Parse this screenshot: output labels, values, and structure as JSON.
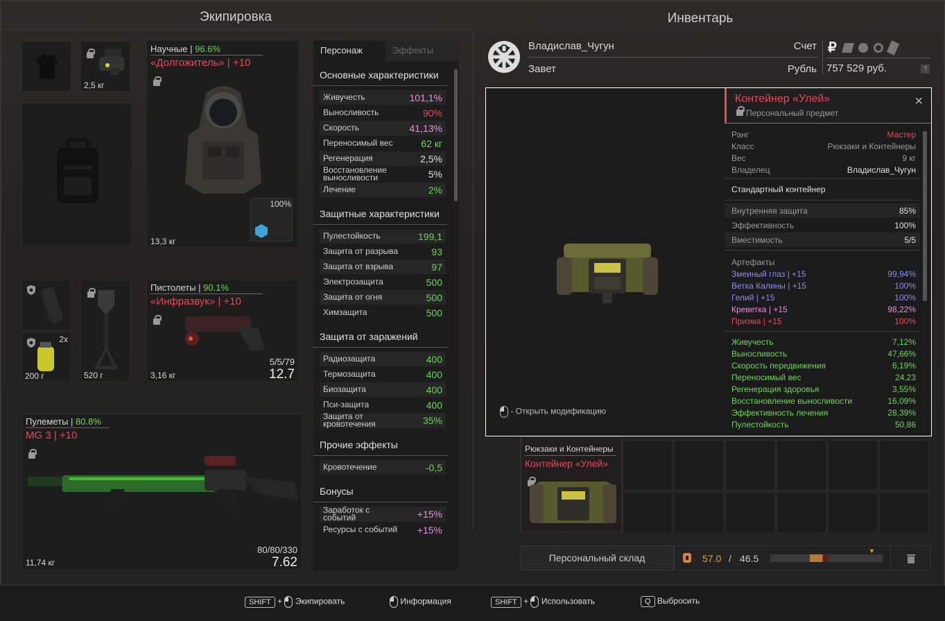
{
  "headers": {
    "equipment": "Экипировка",
    "inventory": "Инвентарь"
  },
  "slots": {
    "nv_weight": "2,5 кг",
    "armor": {
      "category": "Научные",
      "sep": " | ",
      "durability": "96.6%",
      "name": "«Долгожитель» | +10",
      "weight": "13,3 кг",
      "sub_pct": "100%"
    },
    "pistol": {
      "category": "Пистолеты",
      "sep": " | ",
      "durability": "90.1%",
      "name": "«Инфразвук» | +10",
      "weight": "3,16 кг",
      "ammo": "5/5/79",
      "dps": "12.7"
    },
    "consumable1_weight": "200 г",
    "consumable1_count": "2x",
    "shovel_weight": "520 г",
    "mg": {
      "category": "Пулеметы",
      "sep": " | ",
      "durability": "80.8%",
      "name": "MG 3 | +10",
      "weight": "11,74 кг",
      "ammo": "80/80/330",
      "dps": "7.62"
    }
  },
  "stats": {
    "tabs": [
      "Персонаж",
      "Эффекты"
    ],
    "sections": [
      {
        "title": "Основные характеристики",
        "rows": [
          {
            "label": "Живучесть",
            "value": "101,1%",
            "color": "#e98fde"
          },
          {
            "label": "Выносливость",
            "value": "90%",
            "color": "#e8485a"
          },
          {
            "label": "Скорость",
            "value": "41,13%",
            "color": "#e98fde"
          },
          {
            "label": "Переносимый вес",
            "value": "62 кг",
            "color": "#6fd45c"
          },
          {
            "label": "Регенерация",
            "value": "2,5%",
            "color": "#e0e0e0"
          },
          {
            "label": "Восстановление выносливости",
            "value": "5%",
            "color": "#e0e0e0"
          },
          {
            "label": "Лечение",
            "value": "2%",
            "color": "#6fd45c"
          }
        ]
      },
      {
        "title": "Защитные характеристики",
        "rows": [
          {
            "label": "Пулестойкость",
            "value": "199,1",
            "color": "#6fd45c"
          },
          {
            "label": "Защита от разрыва",
            "value": "93",
            "color": "#6fd45c"
          },
          {
            "label": "Защита от взрыва",
            "value": "97",
            "color": "#6fd45c"
          },
          {
            "label": "Электрозащита",
            "value": "500",
            "color": "#6fd45c"
          },
          {
            "label": "Защита от огня",
            "value": "500",
            "color": "#6fd45c"
          },
          {
            "label": "Химзащита",
            "value": "500",
            "color": "#6fd45c"
          }
        ]
      },
      {
        "title": "Защита от заражений",
        "rows": [
          {
            "label": "Радиозащита",
            "value": "400",
            "color": "#6fd45c"
          },
          {
            "label": "Термозащита",
            "value": "400",
            "color": "#6fd45c"
          },
          {
            "label": "Биозащита",
            "value": "400",
            "color": "#6fd45c"
          },
          {
            "label": "Пси-защита",
            "value": "400",
            "color": "#6fd45c"
          },
          {
            "label": "Защита от кровотечения",
            "value": "35%",
            "color": "#6fd45c"
          }
        ]
      },
      {
        "title": "Прочие эффекты",
        "rows": [
          {
            "label": "Кровотечение",
            "value": "-0,5",
            "color": "#6fd45c"
          }
        ]
      },
      {
        "title": "Бонусы",
        "rows": [
          {
            "label": "Заработок с событий",
            "value": "+15%",
            "color": "#e98fde"
          },
          {
            "label": "Ресурсы с событий",
            "value": "+15%",
            "color": "#e98fde"
          }
        ]
      }
    ]
  },
  "profile": {
    "name": "Владислав_Чугун",
    "faction": "Завет",
    "account_label": "Счет",
    "currency_label": "Рубль",
    "balance": "757 529 руб.",
    "help": "?"
  },
  "detail": {
    "title": "Контейнер «Улей»",
    "subtitle": "Персональный предмет",
    "info": [
      {
        "k": "Ранг",
        "v": "Мастер",
        "c": "#e8485a"
      },
      {
        "k": "Класс",
        "v": "Рюкзаки и Контейнеры",
        "c": "#9a9a9a"
      },
      {
        "k": "Вес",
        "v": "9 кг",
        "c": "#9a9a9a"
      },
      {
        "k": "Владелец",
        "v": "Владислав_Чугун",
        "c": "#e0e0e0"
      }
    ],
    "type": "Стандартный контейнер",
    "props": [
      {
        "k": "Внутренняя защита",
        "v": "85%"
      },
      {
        "k": "Эффективность",
        "v": "100%"
      },
      {
        "k": "Вместимость",
        "v": "5/5"
      }
    ],
    "artifacts_title": "Артефакты",
    "artifacts": [
      {
        "k": "Змеиный глаз | +15",
        "v": "99,94%",
        "c": "#8f8cf0"
      },
      {
        "k": "Ветка Калины | +15",
        "v": "100%",
        "c": "#8f8cf0"
      },
      {
        "k": "Гелий | +15",
        "v": "100%",
        "c": "#8f8cf0"
      },
      {
        "k": "Креветка | +15",
        "v": "98,22%",
        "c": "#e98fde"
      },
      {
        "k": "Призма | +15",
        "v": "100%",
        "c": "#e8485a"
      }
    ],
    "bonuses": [
      {
        "k": "Живучесть",
        "v": "7,12%"
      },
      {
        "k": "Выносливость",
        "v": "47,66%"
      },
      {
        "k": "Скорость передвижения",
        "v": "6,19%"
      },
      {
        "k": "Переносимый вес",
        "v": "24,23"
      },
      {
        "k": "Регенерация здоровья",
        "v": "3,55%"
      },
      {
        "k": "Восстановление выносливости",
        "v": "16,09%"
      },
      {
        "k": "Эффективность лечения",
        "v": "28,39%"
      },
      {
        "k": "Пулестойкость",
        "v": "50,86"
      }
    ],
    "mod_hint": "- Открыть модификацию"
  },
  "inv_item": {
    "category": "Рюкзаки и Контейнеры",
    "name": "Контейнер «Улей»"
  },
  "storage": {
    "button": "Персональный склад",
    "weight_current": "57.0",
    "weight_sep": "/",
    "weight_max": "46.5",
    "weight_fill": 0.52
  },
  "footer": {
    "shift": "SHIFT",
    "plus": "+",
    "equip": "Экипировать",
    "info": "Информация",
    "use": "Использовать",
    "q": "Q",
    "drop": "Выбросить"
  }
}
